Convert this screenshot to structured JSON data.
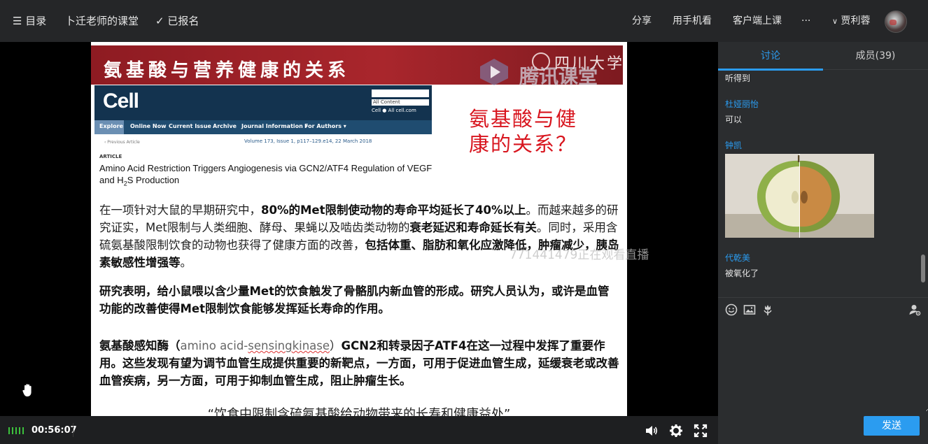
{
  "topbar": {
    "menu_label": "目录",
    "course_title": "卜迁老师的课堂",
    "enrolled_label": "已报名",
    "share": "分享",
    "phone_watch": "用手机看",
    "client_class": "客户端上课",
    "more": "···",
    "user_name": "贾利蓉"
  },
  "slide": {
    "banner_title": "氨基酸与营养健康的关系",
    "university": "四川大学",
    "watermark": "腾讯课堂",
    "cell": {
      "logo": "Cell",
      "all_content": "All Content",
      "radio_options": "Cell ● All cell.com",
      "nav": [
        "Explore",
        "Online Now",
        "Current Issue",
        "Archive",
        "Journal Information ▾",
        "For Authors ▾"
      ],
      "prev_article": "‹ Previous Article",
      "volume_info": "Volume 173, Issue 1, p117–129.e14, 22 March 2018",
      "article_type": "ARTICLE",
      "article_title_main": "Amino Acid Restriction Triggers Angiogenesis via GCN2/ATF4 Regulation of VEGF and H",
      "article_title_sub": "2",
      "article_title_end": "S Production"
    },
    "red_question": "氨基酸与健康的关系？",
    "para1": {
      "t1": "在一项针对大鼠的早期研究中，",
      "b1": "80%的Met限制使动物的寿命平均延长了40%以上",
      "t2": "。而越来越多的研究证实，Met限制与人类细胞、酵母、果蝇以及啮齿类动物的",
      "b2": "衰老延迟和寿命延长有关",
      "t3": "。同时，采用含硫氨基酸限制饮食的动物也获得了健康方面的改善，",
      "b3": "包括体重、脂肪和氧化应激降低，肿瘤减少，胰岛素敏感性增强等",
      "t4": "。"
    },
    "para2": "研究表明，给小鼠喂以含少量Met的饮食触发了骨骼肌内新血管的形成。研究人员认为，或许是血管功能的改善使得Met限制饮食能够发挥延长寿命的作用。",
    "para3": {
      "t1": "氨基酸感知酶（",
      "t2": "amino acid-",
      "t3": "sensingkinase",
      "t4": "）",
      "b1": "GCN2和转录因子ATF4在这一过程中发挥了重要作用。这些发现有望为调节血管生成提供重要的新靶点，一方面，可用于促进血管生成，延缓衰老或改善血管疾病，另一方面，可用于抑制血管生成，阻止肿瘤生长。"
    },
    "quote": "“饮食中限制含硫氨基酸给动物带来的长寿和健康益处”"
  },
  "live_watermark": "771441479正在观看直播",
  "controls": {
    "time": "00:56:07"
  },
  "panel": {
    "tab_discuss": "讨论",
    "tab_members": "成员(39)",
    "messages": [
      {
        "name": "",
        "text": "听得到"
      },
      {
        "name": "杜娅丽怡",
        "text": "可以"
      },
      {
        "name": "钟凯",
        "text": ""
      },
      {
        "name": "代乾美",
        "text": "被氧化了"
      }
    ],
    "send": "发送"
  },
  "colors": {
    "accent": "#2b9cf0",
    "banner_red": "#a9262c",
    "question_red": "#d8151e",
    "signal_green": "#3cc13c"
  }
}
